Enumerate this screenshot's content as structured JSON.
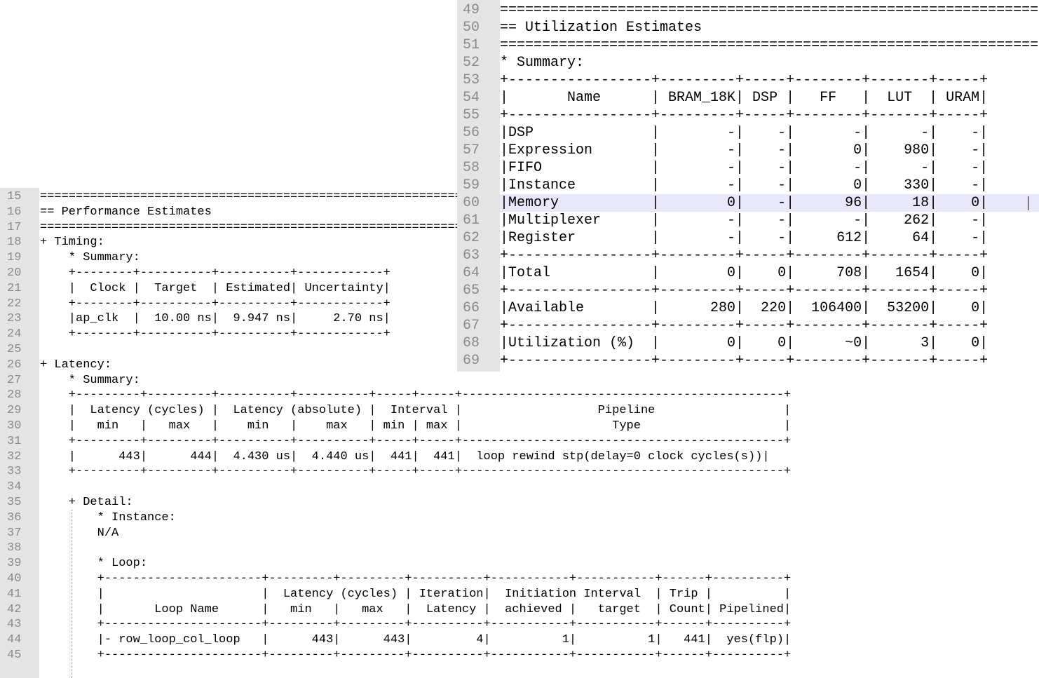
{
  "performance_pane": {
    "lines": [
      {
        "n": "15",
        "text": "================================================================"
      },
      {
        "n": "16",
        "text": "== Performance Estimates"
      },
      {
        "n": "17",
        "text": "================================================================"
      },
      {
        "n": "18",
        "text": "+ Timing:"
      },
      {
        "n": "19",
        "text": "    * Summary:"
      },
      {
        "n": "20",
        "text": "    +--------+----------+----------+------------+"
      },
      {
        "n": "21",
        "text": "    |  Clock |  Target  | Estimated| Uncertainty|"
      },
      {
        "n": "22",
        "text": "    +--------+----------+----------+------------+"
      },
      {
        "n": "23",
        "text": "    |ap_clk  |  10.00 ns|  9.947 ns|     2.70 ns|"
      },
      {
        "n": "24",
        "text": "    +--------+----------+----------+------------+"
      },
      {
        "n": "25",
        "text": ""
      },
      {
        "n": "26",
        "text": "+ Latency:"
      },
      {
        "n": "27",
        "text": "    * Summary:"
      },
      {
        "n": "28",
        "text": "    +---------+---------+----------+----------+-----+-----+---------------------------------------------+"
      },
      {
        "n": "29",
        "text": "    |  Latency (cycles) |  Latency (absolute) |  Interval |                   Pipeline                  |"
      },
      {
        "n": "30",
        "text": "    |   min   |   max   |    min   |    max   | min | max |                     Type                    |"
      },
      {
        "n": "31",
        "text": "    +---------+---------+----------+----------+-----+-----+---------------------------------------------+"
      },
      {
        "n": "32",
        "text": "    |      443|      444|  4.430 us|  4.440 us|  441|  441|  loop rewind stp(delay=0 clock cycles(s))|"
      },
      {
        "n": "33",
        "text": "    +---------+---------+----------+----------+-----+-----+---------------------------------------------+"
      },
      {
        "n": "34",
        "text": ""
      },
      {
        "n": "35",
        "text": "    + Detail:"
      },
      {
        "n": "36",
        "text": "        * Instance:"
      },
      {
        "n": "37",
        "text": "        N/A"
      },
      {
        "n": "38",
        "text": ""
      },
      {
        "n": "39",
        "text": "        * Loop:"
      },
      {
        "n": "40",
        "text": "        +----------------------+---------+---------+----------+-----------+-----------+------+----------+"
      },
      {
        "n": "41",
        "text": "        |                      |  Latency (cycles) | Iteration|  Initiation Interval  | Trip |          |"
      },
      {
        "n": "42",
        "text": "        |       Loop Name      |   min   |   max   |  Latency |  achieved |   target  | Count| Pipelined|"
      },
      {
        "n": "43",
        "text": "        +----------------------+---------+---------+----------+-----------+-----------+------+----------+"
      },
      {
        "n": "44",
        "text": "        |- row_loop_col_loop   |      443|      443|         4|          1|          1|   441|  yes(flp)|"
      },
      {
        "n": "45",
        "text": "        +----------------------+---------+---------+----------+-----------+-----------+------+----------+"
      }
    ]
  },
  "utilization_pane": {
    "lines": [
      {
        "n": "49",
        "text": "================================================================"
      },
      {
        "n": "50",
        "text": "== Utilization Estimates"
      },
      {
        "n": "51",
        "text": "================================================================"
      },
      {
        "n": "52",
        "text": "* Summary:"
      },
      {
        "n": "53",
        "text": "+-----------------+---------+-----+--------+-------+-----+"
      },
      {
        "n": "54",
        "text": "|       Name      | BRAM_18K| DSP |   FF   |  LUT  | URAM|"
      },
      {
        "n": "55",
        "text": "+-----------------+---------+-----+--------+-------+-----+"
      },
      {
        "n": "56",
        "text": "|DSP              |        -|    -|       -|      -|    -|"
      },
      {
        "n": "57",
        "text": "|Expression       |        -|    -|       0|    980|    -|"
      },
      {
        "n": "58",
        "text": "|FIFO             |        -|    -|       -|      -|    -|"
      },
      {
        "n": "59",
        "text": "|Instance         |        -|    -|       0|    330|    -|"
      },
      {
        "n": "60",
        "text": "|Memory           |        0|    -|      96|     18|    0|"
      },
      {
        "n": "61",
        "text": "|Multiplexer      |        -|    -|       -|    262|    -|"
      },
      {
        "n": "62",
        "text": "|Register         |        -|    -|     612|     64|    -|"
      },
      {
        "n": "63",
        "text": "+-----------------+---------+-----+--------+-------+-----+"
      },
      {
        "n": "64",
        "text": "|Total            |        0|    0|     708|   1654|    0|"
      },
      {
        "n": "65",
        "text": "+-----------------+---------+-----+--------+-------+-----+"
      },
      {
        "n": "66",
        "text": "|Available        |      280|  220|  106400|  53200|    0|"
      },
      {
        "n": "67",
        "text": "+-----------------+---------+-----+--------+-------+-----+"
      },
      {
        "n": "68",
        "text": "|Utilization (%)  |        0|    0|      ~0|      3|    0|"
      },
      {
        "n": "69",
        "text": "+-----------------+---------+-----+--------+-------+-----+"
      }
    ]
  }
}
